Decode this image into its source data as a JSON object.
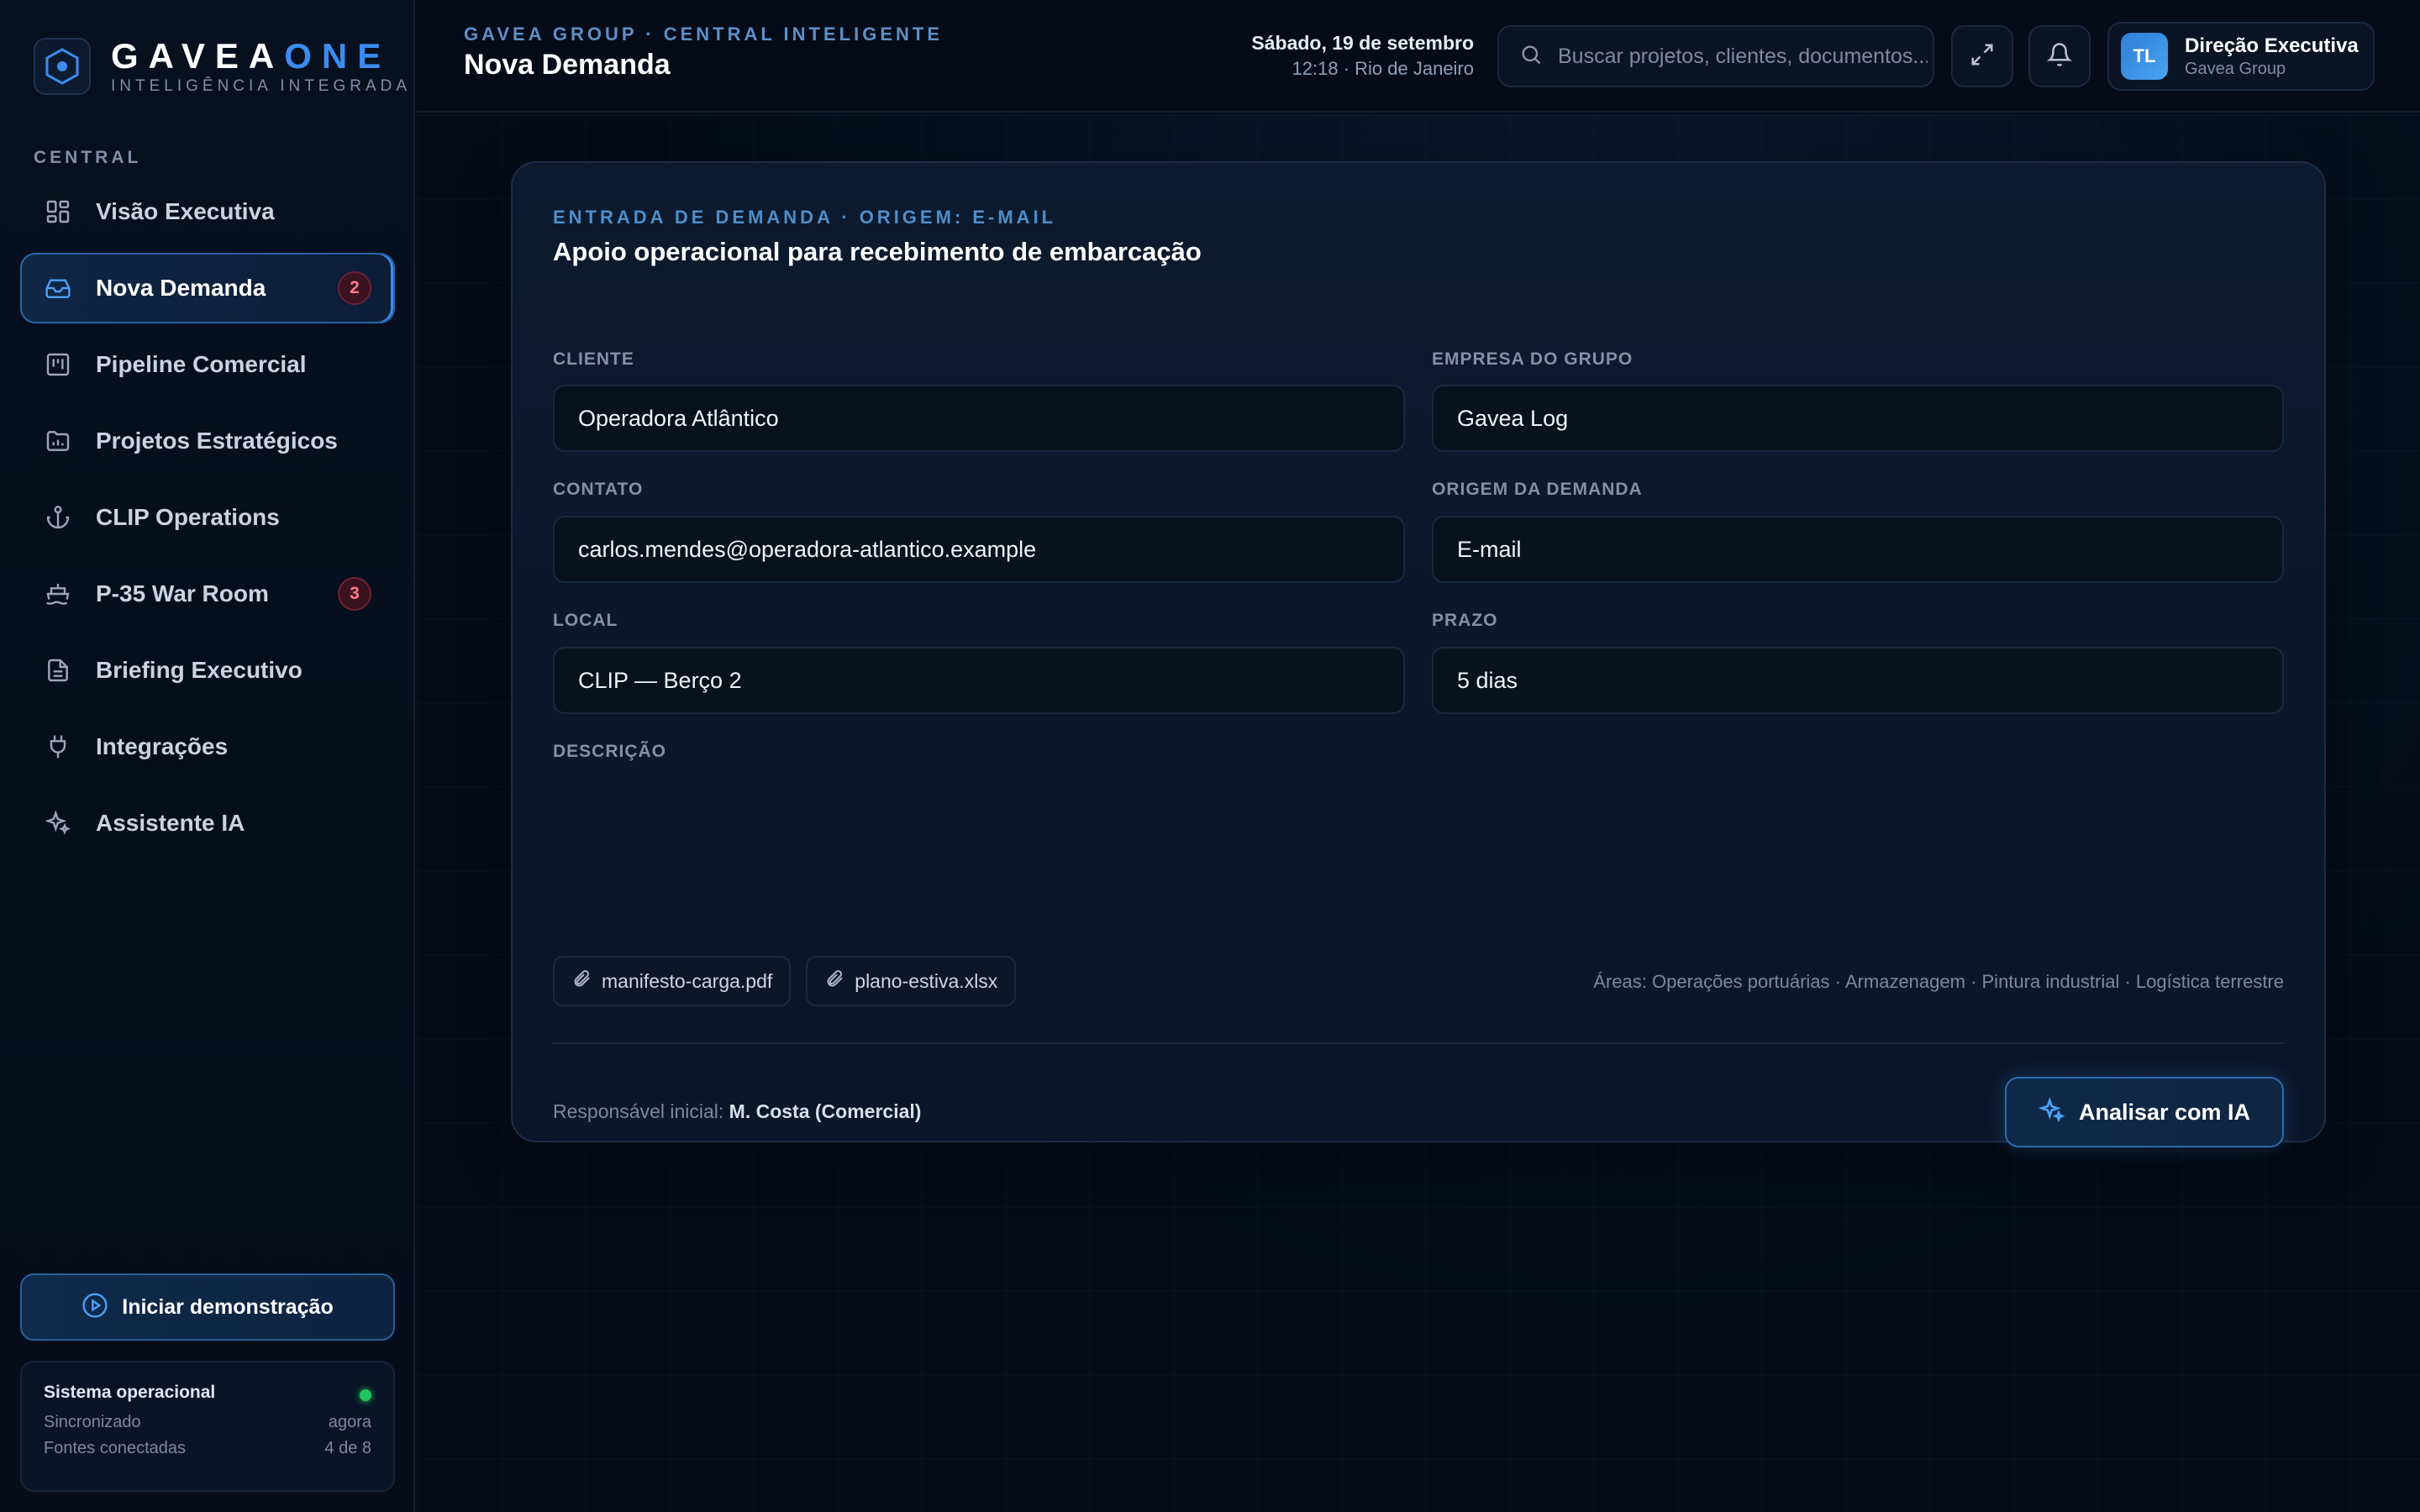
{
  "colors": {
    "accent": "#3b8cf0",
    "badge": "#ff7a8a",
    "status_ok": "#22c55e",
    "background": "#050b1a"
  },
  "brand": {
    "name_primary": "GAVEA",
    "name_accent": "ONE",
    "tagline": "INTELIGÊNCIA INTEGRADA"
  },
  "sidebar": {
    "section_label": "CENTRAL",
    "items": [
      {
        "label": "Visão Executiva",
        "icon": "dashboard-icon",
        "active": false
      },
      {
        "label": "Nova Demanda",
        "icon": "inbox-icon",
        "active": true,
        "badge": "2"
      },
      {
        "label": "Pipeline Comercial",
        "icon": "kanban-icon",
        "active": false
      },
      {
        "label": "Projetos Estratégicos",
        "icon": "folder-chart-icon",
        "active": false
      },
      {
        "label": "CLIP Operations",
        "icon": "anchor-icon",
        "active": false
      },
      {
        "label": "P-35 War Room",
        "icon": "ship-icon",
        "active": false,
        "badge": "3"
      },
      {
        "label": "Briefing Executivo",
        "icon": "document-icon",
        "active": false
      },
      {
        "label": "Integrações",
        "icon": "plug-icon",
        "active": false
      },
      {
        "label": "Assistente IA",
        "icon": "sparkles-icon",
        "active": false
      }
    ],
    "demo_button": "Iniciar demonstração",
    "status": {
      "title": "Sistema operacional",
      "rows": [
        {
          "label": "Sincronizado",
          "value": "agora"
        },
        {
          "label": "Fontes conectadas",
          "value": "4 de 8"
        }
      ]
    }
  },
  "header": {
    "breadcrumb": "GAVEA GROUP · CENTRAL INTELIGENTE",
    "title": "Nova Demanda",
    "date": "Sábado, 19 de setembro",
    "time": "12:18 · Rio de Janeiro",
    "search_placeholder": "Buscar projetos, clientes, documentos...",
    "user": {
      "initials": "TL",
      "name": "Direção Executiva",
      "org": "Gavea Group"
    }
  },
  "form": {
    "eyebrow": "ENTRADA DE DEMANDA · ORIGEM: E-MAIL",
    "title": "Apoio operacional para recebimento de embarcação",
    "fields": {
      "cliente": {
        "label": "CLIENTE",
        "value": "Operadora Atlântico"
      },
      "empresa": {
        "label": "EMPRESA DO GRUPO",
        "value": "Gavea Log"
      },
      "contato": {
        "label": "CONTATO",
        "value": "carlos.mendes@operadora-atlantico.example"
      },
      "origem": {
        "label": "ORIGEM DA DEMANDA",
        "value": "E-mail"
      },
      "local": {
        "label": "LOCAL",
        "value": "CLIP — Berço 2"
      },
      "prazo": {
        "label": "PRAZO",
        "value": "5 dias"
      },
      "descricao": {
        "label": "DESCRIÇÃO"
      }
    },
    "attachments": [
      "manifesto-carga.pdf",
      "plano-estiva.xlsx"
    ],
    "areas": "Áreas: Operações portuárias · Armazenagem · Pintura industrial · Logística terrestre",
    "responsavel_label": "Responsável inicial:",
    "responsavel_value": "M. Costa (Comercial)",
    "analyze_button": "Analisar com IA"
  }
}
